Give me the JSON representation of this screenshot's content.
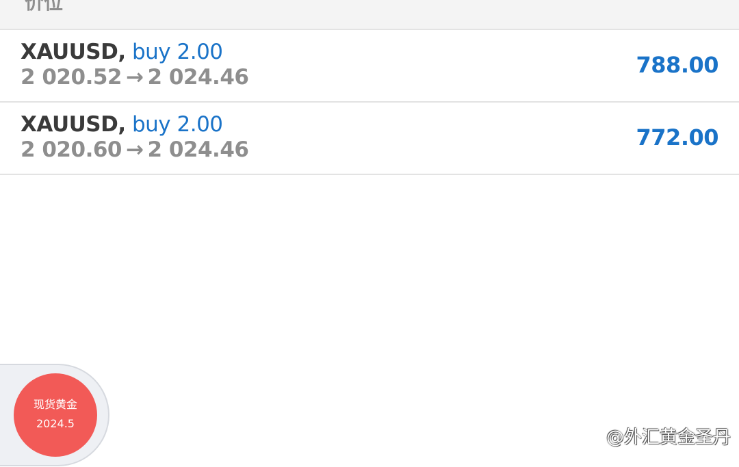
{
  "section_header": {
    "label": "价位"
  },
  "trades": [
    {
      "symbol": "XAUUSD,",
      "side_volume": "buy 2.00",
      "open_price": "2 020.52",
      "arrow": "→",
      "current_price": "2 024.46",
      "profit": "788.00"
    },
    {
      "symbol": "XAUUSD,",
      "side_volume": "buy 2.00",
      "open_price": "2 020.60",
      "arrow": "→",
      "current_price": "2 024.46",
      "profit": "772.00"
    }
  ],
  "floating_badge": {
    "title": "现货黄金",
    "date": "2024.5"
  },
  "watermark": {
    "text": "@外汇黄金圣丹"
  },
  "colors": {
    "accent_blue": "#1a73c8",
    "badge_red": "#f25a57",
    "muted_gray": "#8e8e8e"
  }
}
